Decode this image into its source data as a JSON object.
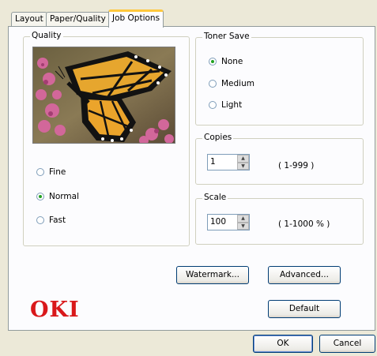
{
  "tabs": [
    {
      "label": "Layout"
    },
    {
      "label": "Paper/Quality"
    },
    {
      "label": "Job Options"
    }
  ],
  "quality": {
    "legend": "Quality",
    "options": [
      {
        "label": "Fine",
        "selected": false
      },
      {
        "label": "Normal",
        "selected": true
      },
      {
        "label": "Fast",
        "selected": false
      }
    ]
  },
  "toner_save": {
    "legend": "Toner Save",
    "options": [
      {
        "label": "None",
        "selected": true
      },
      {
        "label": "Medium",
        "selected": false
      },
      {
        "label": "Light",
        "selected": false
      }
    ]
  },
  "copies": {
    "legend": "Copies",
    "value": "1",
    "range": "( 1-999 )"
  },
  "scale": {
    "legend": "Scale",
    "value": "100",
    "range": "( 1-1000 % )"
  },
  "buttons": {
    "watermark": "Watermark...",
    "advanced": "Advanced...",
    "default": "Default",
    "ok": "OK",
    "cancel": "Cancel"
  },
  "logo": {
    "text": "OKI",
    "color": "#d9181a"
  },
  "colors": {
    "tab_highlight": "#ffc83c",
    "button_border": "#003c74",
    "radio_dot": "#21a121"
  }
}
